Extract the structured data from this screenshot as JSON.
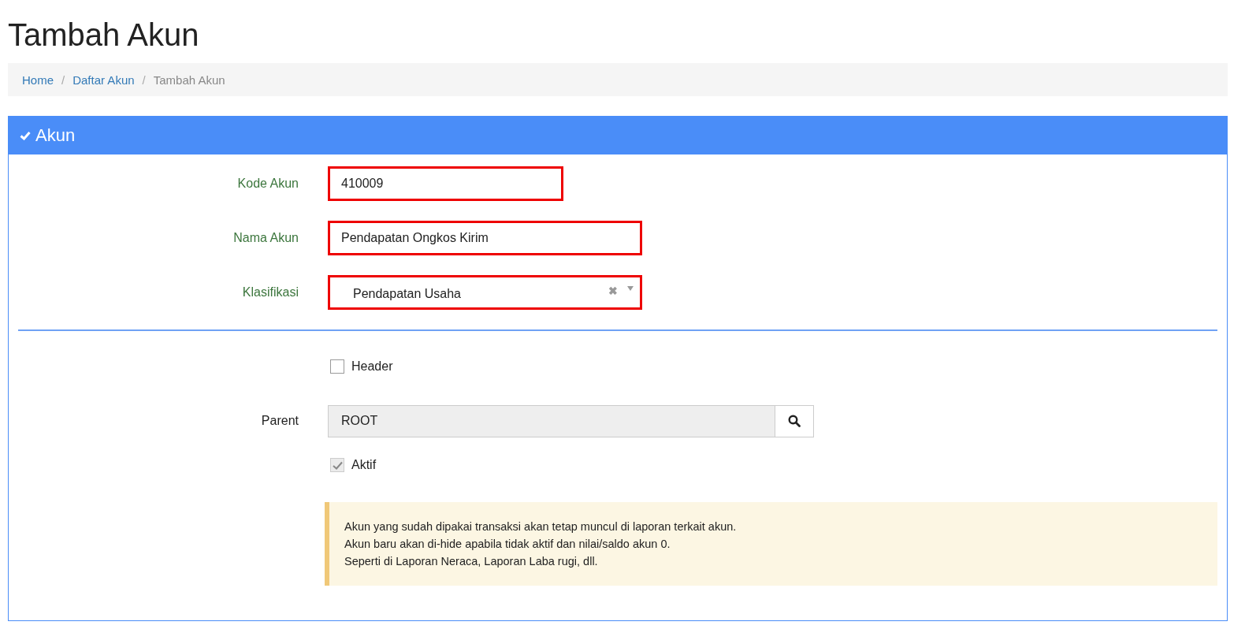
{
  "page_title": "Tambah Akun",
  "breadcrumb": [
    {
      "label": "Home",
      "link": true
    },
    {
      "label": "Daftar Akun",
      "link": true
    },
    {
      "label": "Tambah Akun",
      "link": false
    }
  ],
  "breadcrumb_separator": "/",
  "panel": {
    "title": "Akun",
    "fields": [
      {
        "kind": "text",
        "label": "Kode Akun",
        "value": "410009",
        "valid": true,
        "highlighted": true,
        "wide": false
      },
      {
        "kind": "text",
        "label": "Nama Akun",
        "value": "Pendapatan Ongkos Kirim",
        "valid": true,
        "highlighted": true,
        "wide": true
      },
      {
        "kind": "select",
        "label": "Klasifikasi",
        "value": "Pendapatan Usaha",
        "clear": "✖",
        "valid": true,
        "highlighted": true,
        "wide": true
      }
    ],
    "header_checkbox": {
      "label": "Header",
      "checked": false,
      "disabled": false
    },
    "parent": {
      "label": "Parent",
      "value": "ROOT"
    },
    "aktif_checkbox": {
      "label": "Aktif",
      "checked": true,
      "disabled": true
    },
    "note": [
      "Akun yang sudah dipakai transaksi akan tetap muncul di laporan terkait akun.",
      "Akun baru akan di-hide apabila tidak aktif dan nilai/saldo akun 0.",
      "Seperti di Laporan Neraca, Laporan Laba rugi, dll."
    ]
  }
}
